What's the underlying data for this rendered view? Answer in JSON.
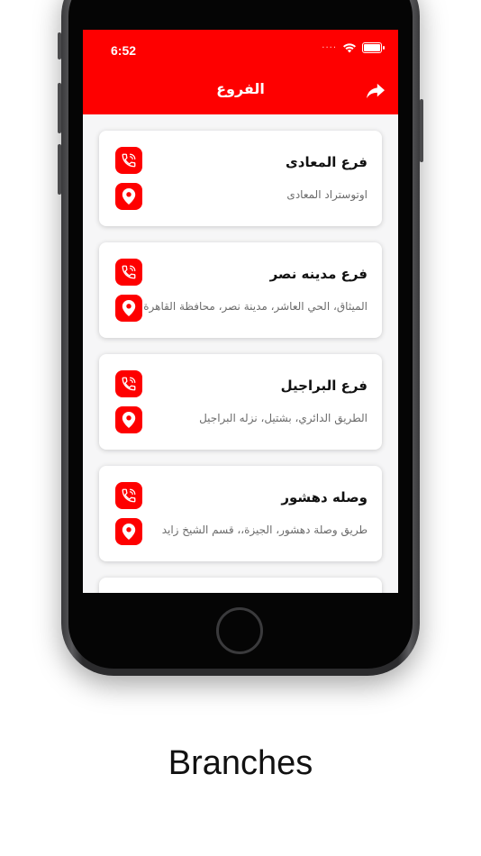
{
  "status": {
    "time": "6:52"
  },
  "header": {
    "title": "الفروع",
    "share_icon": "share-icon"
  },
  "branches": [
    {
      "name": "فرع المعادى",
      "address": "اوتوستراد المعادى"
    },
    {
      "name": "فرع مدينه نصر",
      "address": "الميثاق، الحي العاشر، مدينة نصر، محافظة القاهرة"
    },
    {
      "name": "فرع البراجيل",
      "address": "الطريق الدائري، بشتيل، نزله البراجيل"
    },
    {
      "name": "وصله دهشور",
      "address": "طريق وصلة دهشور، الجيزة،، قسم الشيخ زايد"
    }
  ],
  "caption": "Branches",
  "colors": {
    "accent": "#fe0000",
    "card": "#ffffff",
    "background": "#f6f6f7"
  }
}
